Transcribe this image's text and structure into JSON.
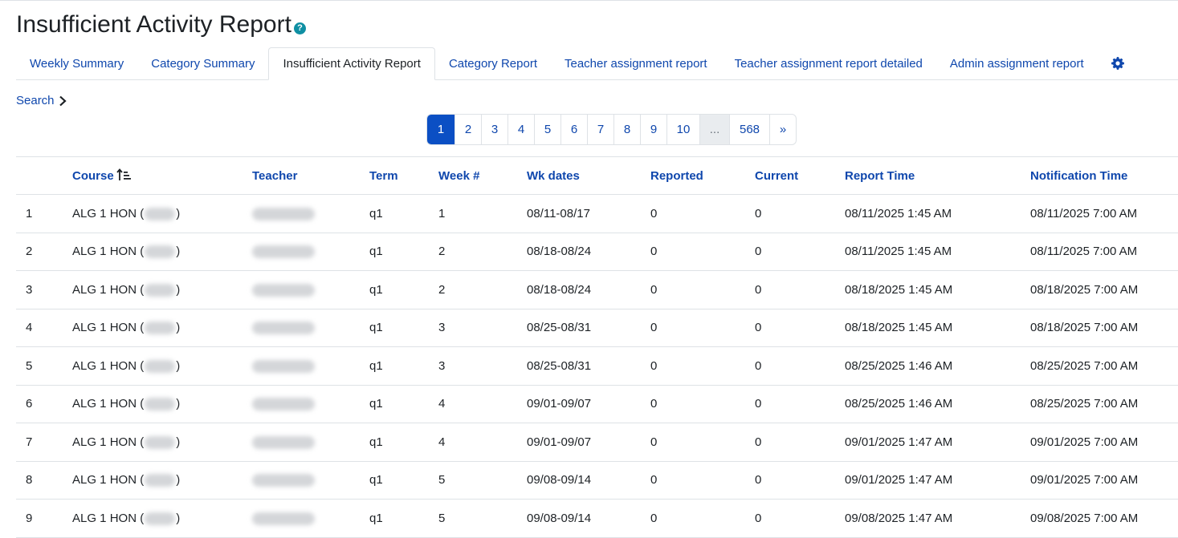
{
  "page": {
    "title": "Insufficient Activity Report",
    "help_icon": "question-circle-icon"
  },
  "tabs": [
    {
      "label": "Weekly Summary",
      "active": false
    },
    {
      "label": "Category Summary",
      "active": false
    },
    {
      "label": "Insufficient Activity Report",
      "active": true
    },
    {
      "label": "Category Report",
      "active": false
    },
    {
      "label": "Teacher assignment report",
      "active": false
    },
    {
      "label": "Teacher assignment report detailed",
      "active": false
    },
    {
      "label": "Admin assignment report",
      "active": false
    }
  ],
  "settings_icon": "gear-icon",
  "search": {
    "label": "Search",
    "icon": "chevron-right-icon"
  },
  "pagination": {
    "current": "1",
    "pages": [
      "1",
      "2",
      "3",
      "4",
      "5",
      "6",
      "7",
      "8",
      "9",
      "10"
    ],
    "ellipsis": "...",
    "last": "568",
    "next": "»"
  },
  "table": {
    "columns": [
      "",
      "Course",
      "Teacher",
      "Term",
      "Week #",
      "Wk dates",
      "Reported",
      "Current",
      "Report Time",
      "Notification Time"
    ],
    "sorted_column": "Course",
    "sort_icon": "sort-ascending-icon",
    "rows": [
      {
        "idx": "1",
        "course_prefix": "ALG 1 HON (",
        "course_suffix": ")",
        "term": "q1",
        "week": "1",
        "dates": "08/11-08/17",
        "reported": "0",
        "current": "0",
        "report_time": "08/11/2025 1:45 AM",
        "notification_time": "08/11/2025 7:00 AM"
      },
      {
        "idx": "2",
        "course_prefix": "ALG 1 HON (",
        "course_suffix": ")",
        "term": "q1",
        "week": "2",
        "dates": "08/18-08/24",
        "reported": "0",
        "current": "0",
        "report_time": "08/11/2025 1:45 AM",
        "notification_time": "08/11/2025 7:00 AM"
      },
      {
        "idx": "3",
        "course_prefix": "ALG 1 HON (",
        "course_suffix": ")",
        "term": "q1",
        "week": "2",
        "dates": "08/18-08/24",
        "reported": "0",
        "current": "0",
        "report_time": "08/18/2025 1:45 AM",
        "notification_time": "08/18/2025 7:00 AM"
      },
      {
        "idx": "4",
        "course_prefix": "ALG 1 HON (",
        "course_suffix": ")",
        "term": "q1",
        "week": "3",
        "dates": "08/25-08/31",
        "reported": "0",
        "current": "0",
        "report_time": "08/18/2025 1:45 AM",
        "notification_time": "08/18/2025 7:00 AM"
      },
      {
        "idx": "5",
        "course_prefix": "ALG 1 HON (",
        "course_suffix": ")",
        "term": "q1",
        "week": "3",
        "dates": "08/25-08/31",
        "reported": "0",
        "current": "0",
        "report_time": "08/25/2025 1:46 AM",
        "notification_time": "08/25/2025 7:00 AM"
      },
      {
        "idx": "6",
        "course_prefix": "ALG 1 HON (",
        "course_suffix": ")",
        "term": "q1",
        "week": "4",
        "dates": "09/01-09/07",
        "reported": "0",
        "current": "0",
        "report_time": "08/25/2025 1:46 AM",
        "notification_time": "08/25/2025 7:00 AM"
      },
      {
        "idx": "7",
        "course_prefix": "ALG 1 HON (",
        "course_suffix": ")",
        "term": "q1",
        "week": "4",
        "dates": "09/01-09/07",
        "reported": "0",
        "current": "0",
        "report_time": "09/01/2025 1:47 AM",
        "notification_time": "09/01/2025 7:00 AM"
      },
      {
        "idx": "8",
        "course_prefix": "ALG 1 HON (",
        "course_suffix": ")",
        "term": "q1",
        "week": "5",
        "dates": "09/08-09/14",
        "reported": "0",
        "current": "0",
        "report_time": "09/01/2025 1:47 AM",
        "notification_time": "09/01/2025 7:00 AM"
      },
      {
        "idx": "9",
        "course_prefix": "ALG 1 HON (",
        "course_suffix": ")",
        "term": "q1",
        "week": "5",
        "dates": "09/08-09/14",
        "reported": "0",
        "current": "0",
        "report_time": "09/08/2025 1:47 AM",
        "notification_time": "09/08/2025 7:00 AM"
      }
    ]
  }
}
